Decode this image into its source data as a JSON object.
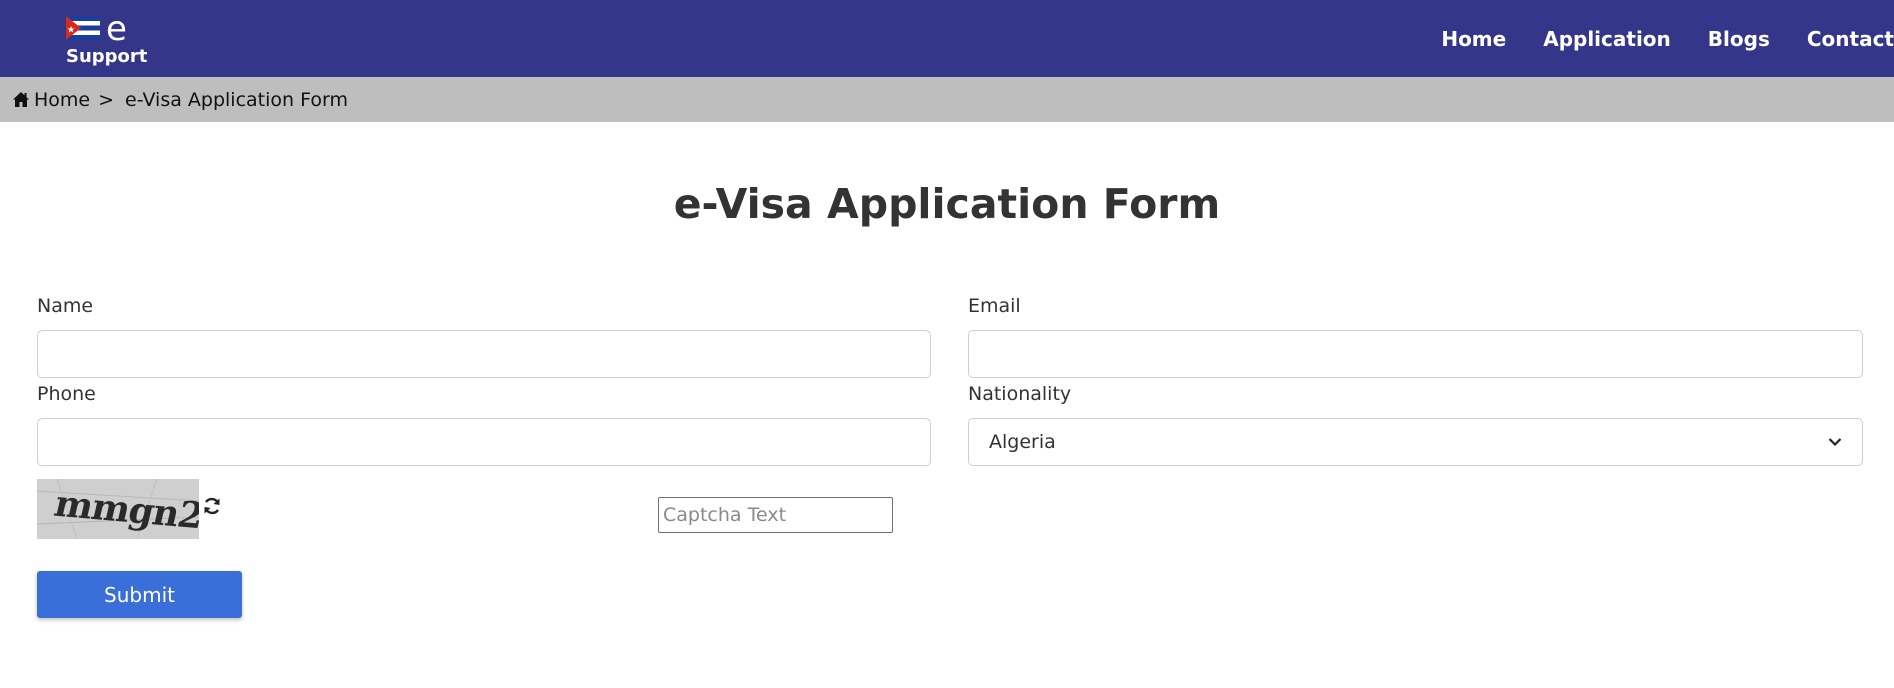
{
  "colors": {
    "navbar_bg": "#343789",
    "breadcrumb_bg": "#bebebe",
    "submit_bg": "#3a6fd9"
  },
  "logo": {
    "letter": "e",
    "subtitle": "Support",
    "icon": "flag-icon"
  },
  "nav": {
    "items": [
      {
        "label": "Home"
      },
      {
        "label": "Application"
      },
      {
        "label": "Blogs"
      },
      {
        "label": "Contact"
      }
    ]
  },
  "breadcrumb": {
    "home_icon": "home-icon",
    "home_label": "Home",
    "separator": ">",
    "current": "e-Visa Application Form"
  },
  "form": {
    "title": "e-Visa Application Form",
    "name": {
      "label": "Name",
      "value": ""
    },
    "email": {
      "label": "Email",
      "value": ""
    },
    "phone": {
      "label": "Phone",
      "value": ""
    },
    "nationality": {
      "label": "Nationality",
      "selected": "Algeria"
    },
    "captcha": {
      "image_text": "mmgn2",
      "refresh_icon": "refresh-icon",
      "placeholder": "Captcha Text",
      "value": ""
    },
    "submit_label": "Submit"
  }
}
